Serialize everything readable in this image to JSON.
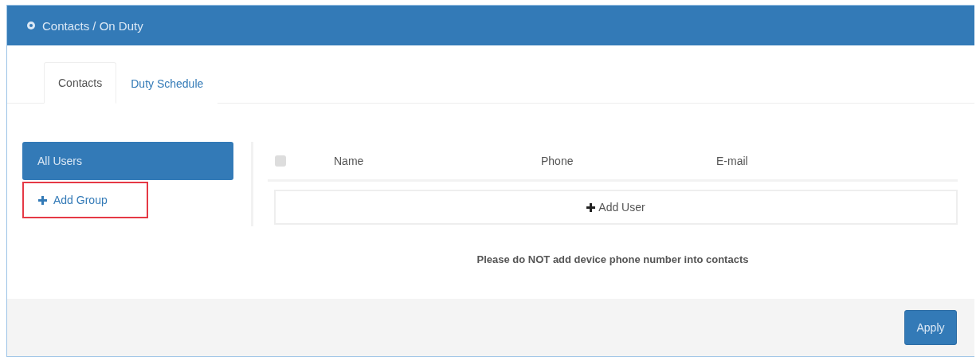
{
  "header": {
    "title": "Contacts / On Duty"
  },
  "tabs": [
    {
      "label": "Contacts",
      "selected": true
    },
    {
      "label": "Duty Schedule",
      "selected": false
    }
  ],
  "sidebar": {
    "items": [
      {
        "label": "All Users",
        "selected": true
      }
    ],
    "add_group": {
      "label": "Add Group",
      "highlighted": true
    }
  },
  "table": {
    "select_all": {
      "checked": false
    },
    "columns": [
      "Name",
      "Phone",
      "E-mail"
    ],
    "add_user": "Add User"
  },
  "note": "Please do NOT add device phone number into contacts",
  "footer": {
    "apply": "Apply"
  }
}
